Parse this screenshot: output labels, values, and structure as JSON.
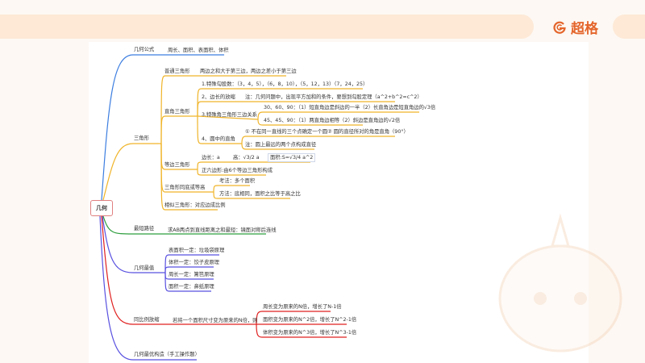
{
  "brand": {
    "name": "超格",
    "accent": "#e4652b"
  },
  "mindmap": {
    "root": "几何",
    "formula": {
      "label": "几何公式",
      "child": "周长、面积、表面积、体积"
    },
    "triangle": {
      "label": "三角形",
      "ordinary": {
        "label": "普通三角形",
        "child": "两边之和大于第三边，两边之差小于第三边"
      },
      "right": {
        "label": "直角三角形",
        "c1": "1.特殊勾股数：（3，4，5），（6，8，10），（5，12，13）（7，24，25）",
        "c2": "2、边长的放缩",
        "c2note": "注：几何问题中，出现平方加和的条件，要想到勾股定理（a^2+b^2=c^2）",
        "c3": "3.特殊角三角形三边关系",
        "c3a": "30、60、90：（1）短直角边是斜边的一半（2）长直角边是短直角边的√3倍",
        "c3b": "45、45、90：（1）两直角边相等（2）斜边是直角边的√2倍",
        "c4": "4、圆中的直角",
        "c4a": "① 不在同一直线的三个点确定一个圆② 圆的直径所对的角是直角（90°）",
        "c4b": "注：圆上最远的两个点构成直径"
      },
      "equilateral": {
        "label": "等边三角形",
        "side": "边长：a",
        "height": "高：√3/2 a",
        "area": "面积:S=√3/4 a^2",
        "hexagon": "正六边形:由6个等边三角形构成"
      },
      "same_base": {
        "label": "三角形同底或等高",
        "test": "考法：多个面积",
        "method": "方法：底相同，面积之比等于高之比"
      },
      "similar": "相似三角形：对应边成比例"
    },
    "shortest": {
      "label": "最短路径",
      "child": "求AB两点到直线距离之和最短：镜面对称后连线"
    },
    "extreme": {
      "label": "几何最值",
      "items": [
        "表面积一定：垃圾袋原理",
        "体积一定：饺子皮原理",
        "周长一定：篱笆原理",
        "面积一定：鼻纸原理"
      ]
    },
    "scale": {
      "label": "同比例放缩",
      "cond": "若将一个面积尺寸变为原来的N倍，则",
      "items": [
        "周长变为原来的N倍，增长了N-1倍",
        "面积变为原来的N^2倍，增长了N^2-1倍",
        "体积变为原来的N^3倍，增长了N^3-1倍"
      ]
    },
    "construct": "几何最优构造（手工操作题）"
  }
}
